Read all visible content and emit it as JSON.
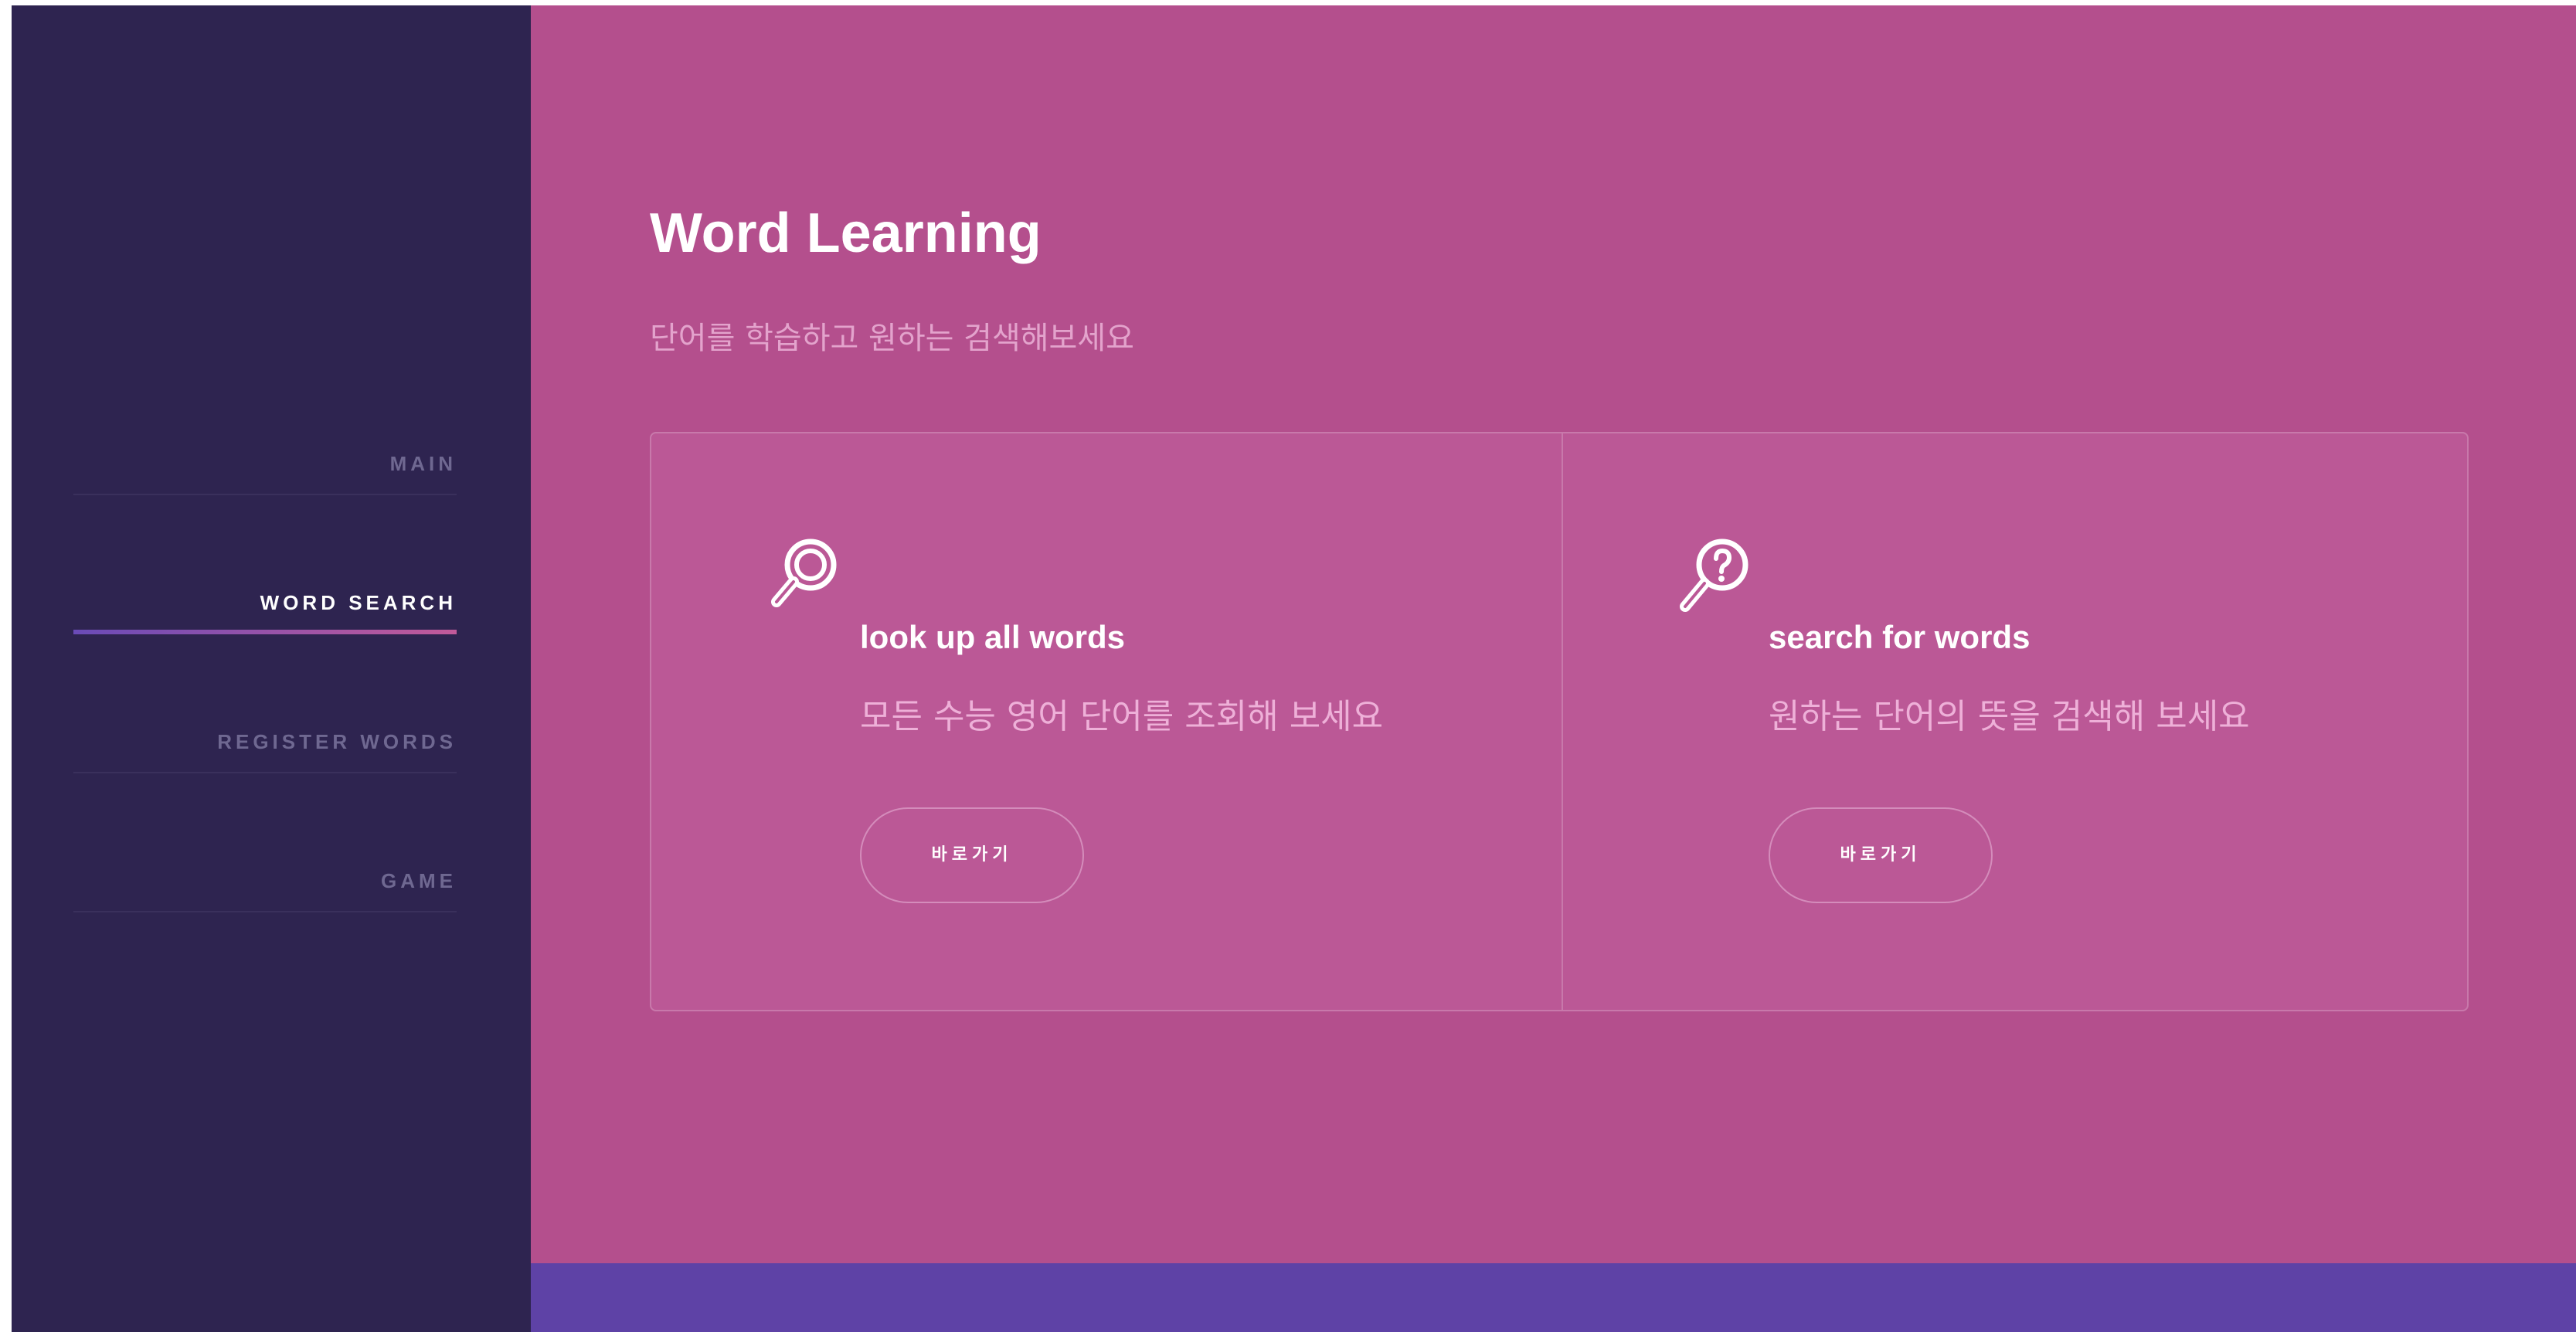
{
  "sidebar": {
    "items": [
      {
        "label": "MAIN",
        "active": false
      },
      {
        "label": "WORD SEARCH",
        "active": true
      },
      {
        "label": "REGISTER WORDS",
        "active": false
      },
      {
        "label": "GAME",
        "active": false
      }
    ]
  },
  "main": {
    "title": "Word Learning",
    "subtitle": "단어를 학습하고 원하는 검색해보세요",
    "cards": [
      {
        "icon": "magnifier-icon",
        "title": "look up all words",
        "description": "모든 수능 영어 단어를 조회해 보세요",
        "button_label": "바로가기"
      },
      {
        "icon": "magnifier-question-icon",
        "title": "search for words",
        "description": "원하는 단어의 뜻을 검색해 보세요",
        "button_label": "바로가기"
      }
    ]
  },
  "colors": {
    "sidebar_bg": "#2e2450",
    "main_bg": "#b44f8d",
    "footer_bar": "#5e42a6",
    "active_underline_start": "#6a4bb7",
    "active_underline_end": "#c25a9a"
  }
}
